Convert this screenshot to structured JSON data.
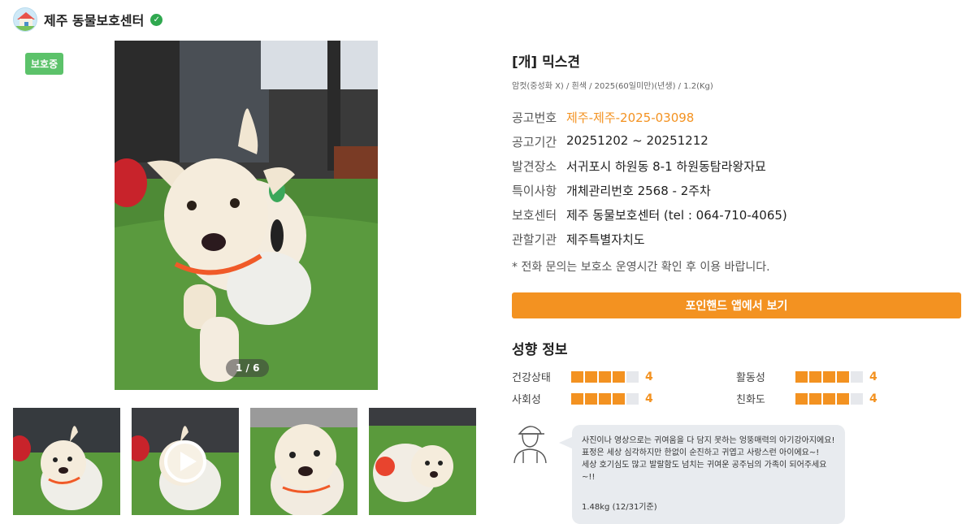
{
  "header": {
    "shelter_name": "제주 동물보호센터",
    "verified_icon": "verified-check-icon",
    "logo_icon": "shelter-house-logo"
  },
  "status_badge": "보호중",
  "gallery": {
    "counter": "1 / 6",
    "thumbnail_count": 4,
    "video_thumbnail_index": 1
  },
  "animal": {
    "title": "[개] 믹스견",
    "subinfo": "암컷(중성화 X) / 흰색 / 2025(60일미만)(년생) / 1.2(Kg)"
  },
  "info": [
    {
      "key": "공고번호",
      "value": "제주-제주-2025-03098",
      "accent": true
    },
    {
      "key": "공고기간",
      "value": "20251202 ~ 20251212",
      "accent": false
    },
    {
      "key": "발견장소",
      "value": "서귀포시 하원동 8-1 하원동탐라왕자묘",
      "accent": false
    },
    {
      "key": "특이사항",
      "value": "개체관리번호 2568 - 2주차",
      "accent": false
    },
    {
      "key": "보호센터",
      "value": "제주 동물보호센터 (tel : 064-710-4065)",
      "accent": false
    },
    {
      "key": "관할기관",
      "value": "제주특별자치도",
      "accent": false
    }
  ],
  "notice": "* 전화 문의는 보호소 운영시간 확인 후 이용 바랍니다.",
  "app_button": "포인핸드 앱에서 보기",
  "traits_title": "성향 정보",
  "traits": [
    {
      "label": "건강상태",
      "value": 4,
      "max": 5
    },
    {
      "label": "활동성",
      "value": 4,
      "max": 5
    },
    {
      "label": "사회성",
      "value": 4,
      "max": 5
    },
    {
      "label": "친화도",
      "value": 4,
      "max": 5
    }
  ],
  "comment": {
    "lines": [
      "사진이나 영상으로는 귀여움을 다 담지 못하는 엉뚱매력의 아기강아지에요!",
      "표정은 세상 심각하지만 한없이 순진하고 귀엽고 사랑스런 아이에요~!",
      "세상 호기심도 많고 발랄함도 넘치는 귀여운 공주님의 가족이 되어주세요~!!"
    ],
    "weight": "1.48kg (12/31기준)"
  },
  "colors": {
    "accent": "#f39221",
    "badge": "#5cc26a",
    "bubble": "#e8ebef"
  }
}
